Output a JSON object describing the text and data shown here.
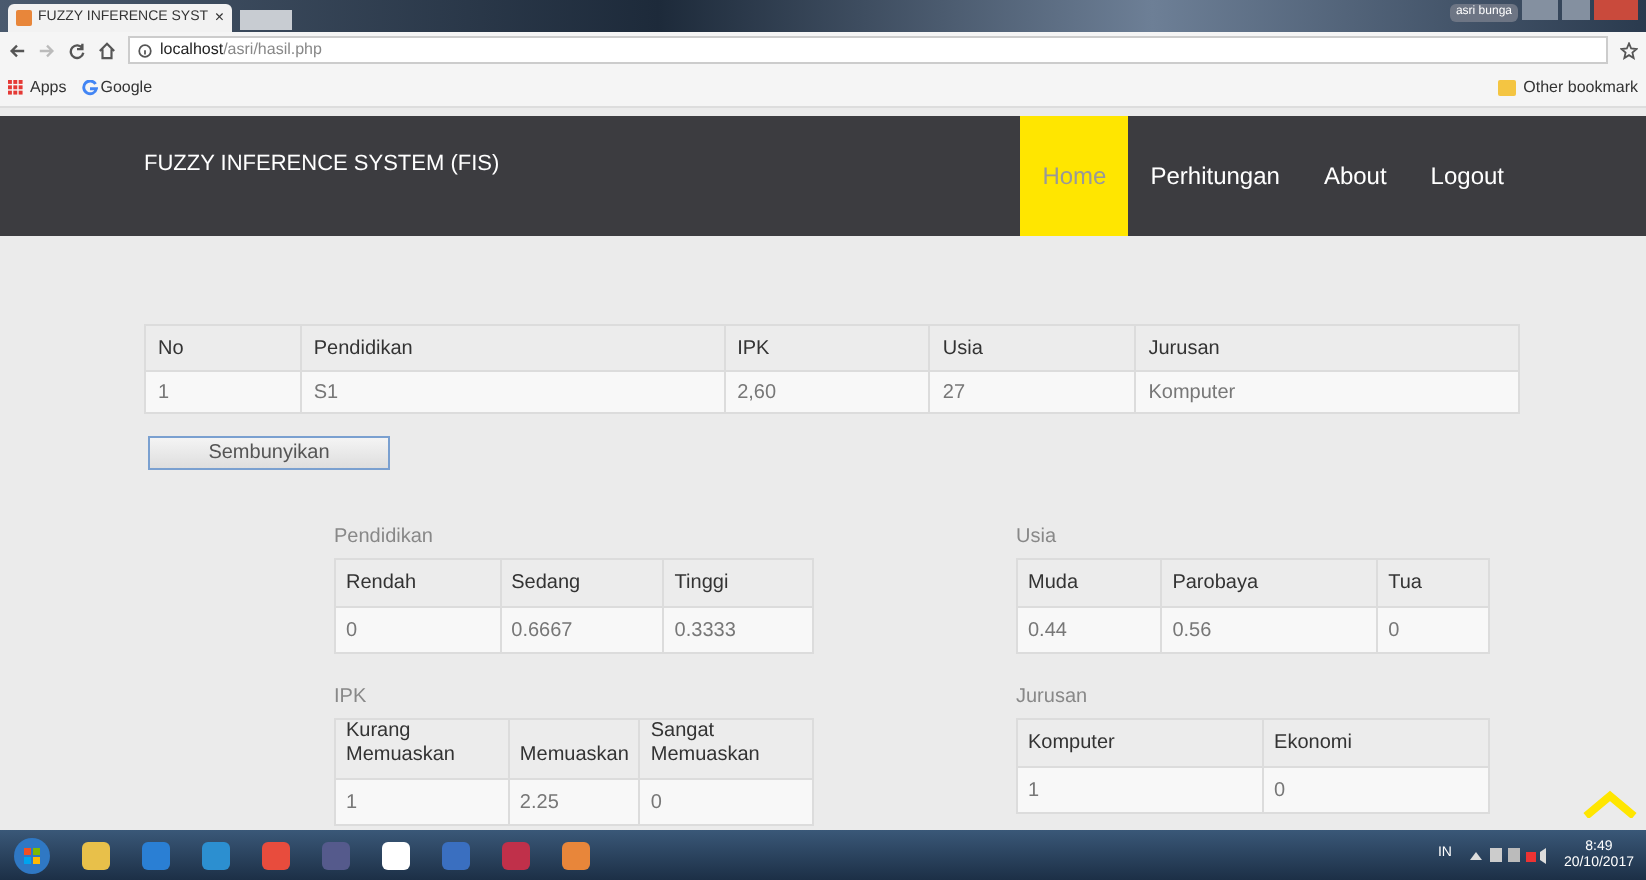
{
  "browser": {
    "tab_title": "FUZZY INFERENCE SYST",
    "tab_close": "×",
    "user": "asri bunga",
    "address_host": "localhost",
    "address_path": "/asri/hasil.php",
    "bookmarks": [
      "Apps",
      "Google"
    ],
    "other_bookmarks": "Other bookmark"
  },
  "navbar": {
    "brand": "FUZZY INFERENCE SYSTEM (FIS)",
    "items": [
      {
        "label": "Home",
        "selected": true
      },
      {
        "label": "Perhitungan",
        "selected": false
      },
      {
        "label": "About",
        "selected": false
      },
      {
        "label": "Logout",
        "selected": false
      }
    ]
  },
  "main_table": {
    "columns": [
      "No",
      "Pendidikan",
      "IPK",
      "Usia",
      "Jurusan"
    ],
    "rows": [
      [
        "1",
        "S1",
        "2,60",
        "27",
        "Komputer"
      ]
    ]
  },
  "toggle_button": "Sembunyikan",
  "sub_tables": [
    {
      "title": "Pendidikan",
      "columns": [
        "Rendah",
        "Sedang",
        "Tinggi"
      ],
      "rows": [
        [
          "0",
          "0.6667",
          "0.3333"
        ]
      ]
    },
    {
      "title": "Usia",
      "columns": [
        "Muda",
        "Parobaya",
        "Tua"
      ],
      "rows": [
        [
          "0.44",
          "0.56",
          "0"
        ]
      ]
    },
    {
      "title": "IPK",
      "columns": [
        "Kurang Memuaskan",
        "Memuaskan",
        "Sangat Memuaskan"
      ],
      "rows": [
        [
          "1",
          "2.25",
          "0"
        ]
      ]
    },
    {
      "title": "Jurusan",
      "columns": [
        "Komputer",
        "Ekonomi"
      ],
      "rows": [
        [
          "1",
          "0"
        ]
      ]
    }
  ],
  "taskbar": {
    "language": "IN",
    "time": "8:49",
    "date": "20/10/2017"
  }
}
